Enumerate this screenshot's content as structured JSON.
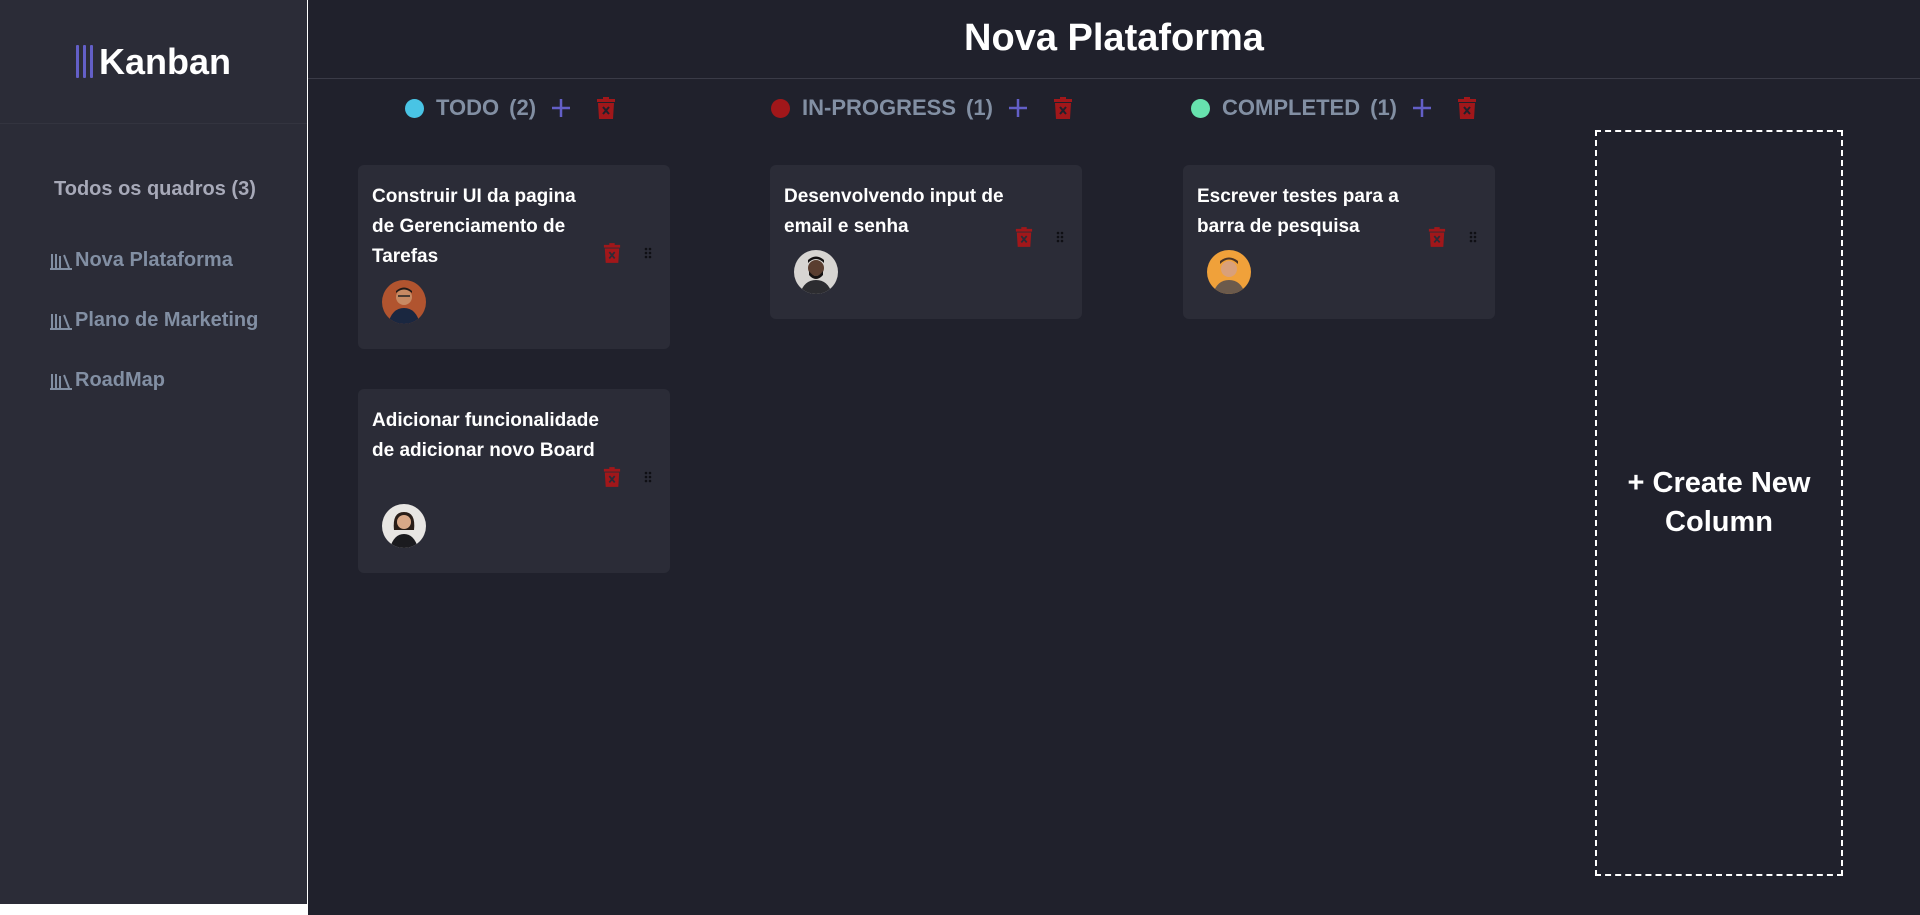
{
  "app": {
    "logo_text": "Kanban"
  },
  "sidebar": {
    "all_boards_label": "Todos os quadros (3)",
    "boards": [
      {
        "label": "Nova Plataforma",
        "icon": "library-icon"
      },
      {
        "label": "Plano de Marketing",
        "icon": "library-icon"
      },
      {
        "label": "RoadMap",
        "icon": "library-icon"
      }
    ]
  },
  "header": {
    "title": "Nova Plataforma"
  },
  "columns": [
    {
      "name": "TODO",
      "count": "(2)",
      "color": "#49c4e5",
      "cards": [
        {
          "title": "Construir UI da pagina de Gerenciamento de Tarefas",
          "avatar": "avatar-man-glasses"
        },
        {
          "title": "Adicionar funcionalidade de adicionar novo Board",
          "avatar": "avatar-woman"
        }
      ]
    },
    {
      "name": "IN-PROGRESS",
      "count": "(1)",
      "color": "#a1171a",
      "cards": [
        {
          "title": "Desenvolvendo input de email e senha",
          "avatar": "avatar-man-beard"
        }
      ]
    },
    {
      "name": "COMPLETED",
      "count": "(1)",
      "color": "#67e2ae",
      "cards": [
        {
          "title": "Escrever testes para a barra de pesquisa",
          "avatar": "avatar-man-young"
        }
      ]
    }
  ],
  "create_column": {
    "label": "+ Create New Column"
  },
  "colors": {
    "accent": "#635fc7",
    "danger": "#a1171a",
    "sidebar_bg": "#2b2c37",
    "main_bg": "#20212c",
    "card_bg": "#2b2c37"
  }
}
